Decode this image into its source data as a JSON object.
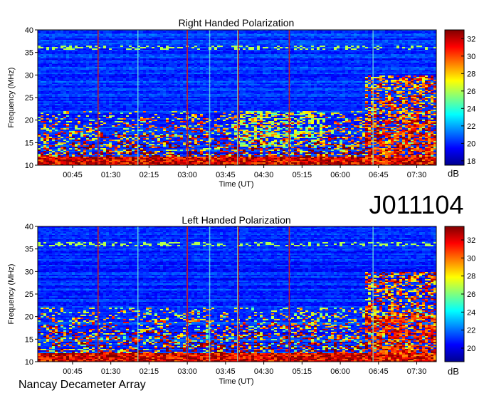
{
  "station_id": "J011104",
  "footer": "Nancay Decameter Array",
  "chart_data": [
    {
      "type": "heatmap",
      "title": "Right Handed Polarization",
      "xlabel": "Time (UT)",
      "ylabel": "Frequency (MHz)",
      "xticks": [
        "00:45",
        "01:30",
        "02:15",
        "03:00",
        "03:45",
        "04:30",
        "05:15",
        "06:00",
        "06:45",
        "07:30"
      ],
      "yticks": [
        "10",
        "15",
        "20",
        "25",
        "30",
        "35",
        "40"
      ],
      "ylim": [
        10,
        40
      ],
      "colorbar_label": "dB",
      "colorbar_ticks": [
        "18",
        "20",
        "22",
        "24",
        "26",
        "28",
        "30",
        "32"
      ],
      "colorbar_range": [
        17.5,
        33
      ],
      "marker_lines": [
        "01:15",
        "03:00",
        "04:00",
        "05:00"
      ]
    },
    {
      "type": "heatmap",
      "title": "Left Handed Polarization",
      "xlabel": "Time (UT)",
      "ylabel": "Frequency (MHz)",
      "xticks": [
        "00:45",
        "01:30",
        "02:15",
        "03:00",
        "03:45",
        "04:30",
        "05:15",
        "06:00",
        "06:45",
        "07:30"
      ],
      "yticks": [
        "10",
        "15",
        "20",
        "25",
        "30",
        "35",
        "40"
      ],
      "ylim": [
        10,
        40
      ],
      "colorbar_label": "dB",
      "colorbar_ticks": [
        "20",
        "22",
        "24",
        "26",
        "28",
        "30",
        "32"
      ],
      "colorbar_range": [
        18.5,
        33.5
      ],
      "marker_lines": [
        "01:15",
        "03:00",
        "04:00",
        "05:00"
      ]
    }
  ]
}
